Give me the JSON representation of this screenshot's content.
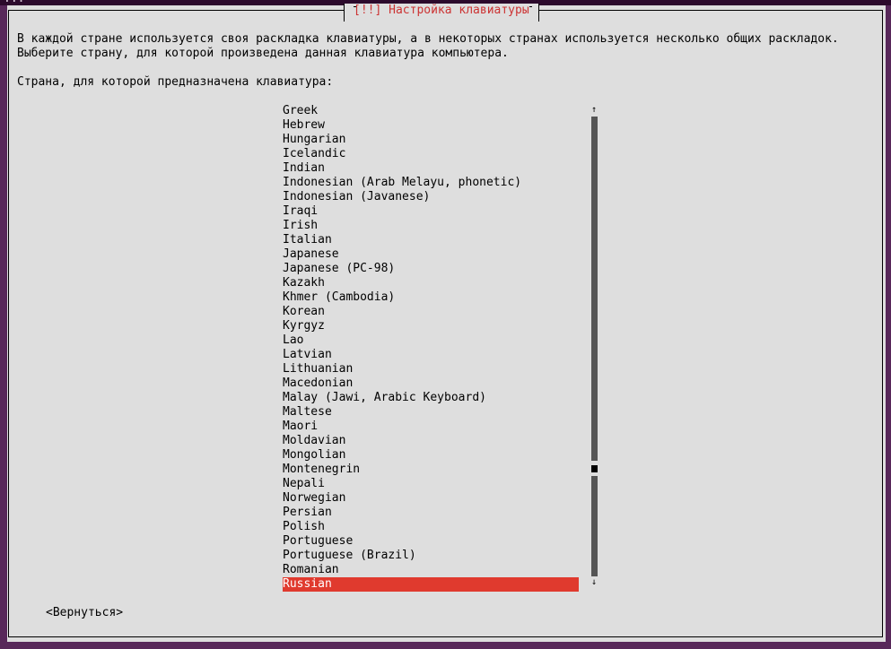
{
  "window": {
    "title_fragment": "..."
  },
  "dialog": {
    "title": "[!!] Настройка клавиатуры",
    "description_line1": "В каждой стране используется своя раскладка клавиатуры, а в некоторых странах используется несколько общих раскладок.",
    "description_line2": "Выберите страну, для которой произведена данная клавиатура компьютера.",
    "prompt": "Страна, для которой предназначена клавиатура:"
  },
  "list": {
    "items": [
      "Greek",
      "Hebrew",
      "Hungarian",
      "Icelandic",
      "Indian",
      "Indonesian (Arab Melayu, phonetic)",
      "Indonesian (Javanese)",
      "Iraqi",
      "Irish",
      "Italian",
      "Japanese",
      "Japanese (PC-98)",
      "Kazakh",
      "Khmer (Cambodia)",
      "Korean",
      "Kyrgyz",
      "Lao",
      "Latvian",
      "Lithuanian",
      "Macedonian",
      "Malay (Jawi, Arabic Keyboard)",
      "Maltese",
      "Maori",
      "Moldavian",
      "Mongolian",
      "Montenegrin",
      "Nepali",
      "Norwegian",
      "Persian",
      "Polish",
      "Portuguese",
      "Portuguese (Brazil)",
      "Romanian",
      "Russian"
    ],
    "selected": "Russian"
  },
  "scrollbar": {
    "up_glyph": "↑",
    "down_glyph": "↓",
    "position": 0.76
  },
  "buttons": {
    "back": "<Вернуться>"
  },
  "colors": {
    "selection": "#e03a2e",
    "title": "#cc3333",
    "background": "#dedede",
    "desktop": "#58285a"
  }
}
